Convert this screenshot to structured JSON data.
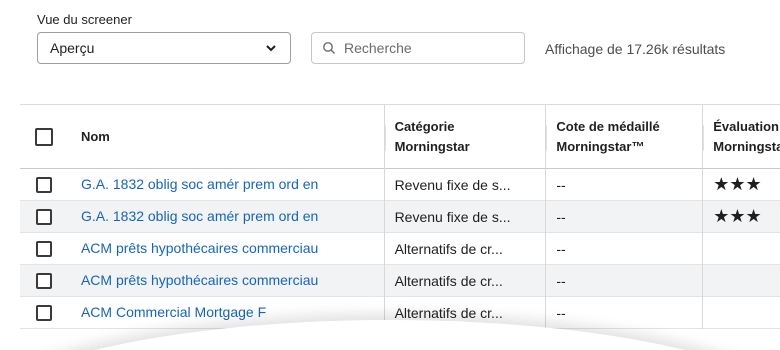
{
  "screener": {
    "view_label": "Vue du screener",
    "view_value": "Aperçu",
    "search_placeholder": "Recherche",
    "results_text": "Affichage de 17.26k résultats"
  },
  "table": {
    "headers": {
      "name": "Nom",
      "category_line1": "Catégorie",
      "category_line2": "Morningstar",
      "medal_line1": "Cote de médaillé",
      "medal_line2": "Morningstar™",
      "rating_line1": "Évaluation",
      "rating_line2": "Morningstar"
    },
    "rows": [
      {
        "name": "G.A. 1832 oblig soc amér prem ord en",
        "category": "Revenu fixe de s...",
        "medal": "--",
        "rating": "★★★",
        "stars": 3
      },
      {
        "name": "G.A. 1832 oblig soc amér prem ord en",
        "category": "Revenu fixe de s...",
        "medal": "--",
        "rating": "★★★",
        "stars": 3
      },
      {
        "name": "ACM prêts hypothécaires commerciau",
        "category": "Alternatifs de cr...",
        "medal": "--",
        "rating": ""
      },
      {
        "name": "ACM prêts hypothécaires commerciau",
        "category": "Alternatifs de cr...",
        "medal": "--",
        "rating": ""
      },
      {
        "name": "ACM Commercial Mortgage F",
        "category": "Alternatifs de cr...",
        "medal": "--",
        "rating": ""
      }
    ]
  },
  "colors": {
    "link": "#1565c0",
    "alt_row": "#f2f3f5"
  },
  "icons": {
    "select_chevron": "chevron-down-icon",
    "search": "search-icon"
  }
}
